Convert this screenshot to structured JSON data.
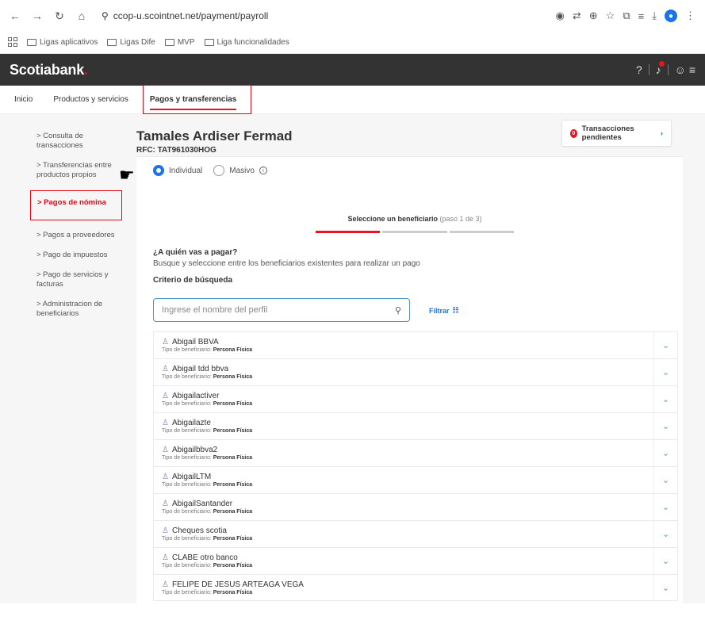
{
  "browser": {
    "url": "ccop-u.scointnet.net/payment/payroll",
    "bookmarks": [
      "Ligas aplicativos",
      "Ligas Dife",
      "MVP",
      "Liga funcionalidades"
    ]
  },
  "brand": {
    "logo": "Scotiabank",
    "accent": "#ec111a"
  },
  "menu": {
    "items": [
      "Inicio",
      "Productos y servicios"
    ],
    "active": "Pagos y transferencias"
  },
  "sidebar": {
    "items": [
      "> Consulta de transacciones",
      "> Transferencias entre productos propios",
      "> Pagos de nómina",
      "> Pagos a proveedores",
      "> Pago de impuestos",
      "> Pago de servicios y facturas",
      "> Administracion de beneficiarios"
    ]
  },
  "profile": {
    "name": "Tamales Ardiser Fermad",
    "rfc": "RFC: TAT961030HOG"
  },
  "pending": {
    "count": "0",
    "label": "Transacciones pendientes"
  },
  "payment_type": {
    "individual": "Individual",
    "masivo": "Masivo",
    "selected": "Individual"
  },
  "steps": {
    "label": "Seleccione un beneficiario",
    "sub": "(paso 1 de 3)"
  },
  "question": {
    "title": "¿A quién vas a pagar?",
    "subtitle": "Busque y seleccione entre los beneficiarios existentes para realizar un pago"
  },
  "search": {
    "criteria_label": "Criterio de búsqueda",
    "placeholder": "Ingrese el nombre del perfil",
    "filter_label": "Filtrar"
  },
  "beneficiaries": {
    "type_label": "Tipo de beneficiario:",
    "items": [
      {
        "name": "Abigail BBVA",
        "type": "Persona Física"
      },
      {
        "name": "Abigail tdd bbva",
        "type": "Persona Física"
      },
      {
        "name": "Abigailactiver",
        "type": "Persona Física"
      },
      {
        "name": "Abigailazte",
        "type": "Persona Física"
      },
      {
        "name": "Abigailbbva2",
        "type": "Persona Física"
      },
      {
        "name": "AbigailLTM",
        "type": "Persona Física"
      },
      {
        "name": "AbigailSantander",
        "type": "Persona Física"
      },
      {
        "name": "Cheques scotia",
        "type": "Persona Física"
      },
      {
        "name": "CLABE otro banco",
        "type": "Persona Física"
      },
      {
        "name": "FELIPE DE JESUS ARTEAGA VEGA",
        "type": "Persona Física"
      }
    ]
  }
}
